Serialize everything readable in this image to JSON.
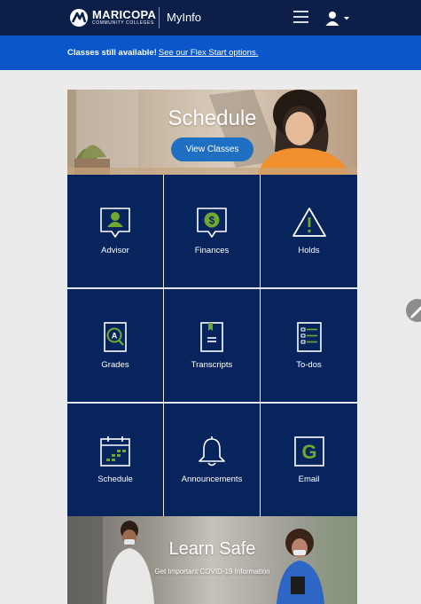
{
  "header": {
    "logo_name": "MARICOPA",
    "logo_sub": "COMMUNITY COLLEGES",
    "app_name": "MyInfo",
    "menu_icon": "hamburger-icon",
    "user_icon": "user-icon"
  },
  "notice": {
    "bold_text": "Classes still available!",
    "link_text": "See our Flex Start options."
  },
  "hero": {
    "title": "Schedule",
    "button_label": "View Classes"
  },
  "tiles": [
    {
      "label": "Advisor",
      "icon": "advisor-icon"
    },
    {
      "label": "Finances",
      "icon": "finances-icon"
    },
    {
      "label": "Holds",
      "icon": "holds-icon"
    },
    {
      "label": "Grades",
      "icon": "grades-icon"
    },
    {
      "label": "Transcripts",
      "icon": "transcripts-icon"
    },
    {
      "label": "To-dos",
      "icon": "todos-icon"
    },
    {
      "label": "Schedule",
      "icon": "schedule-icon"
    },
    {
      "label": "Announcements",
      "icon": "bell-icon"
    },
    {
      "label": "Email",
      "icon": "email-icon"
    }
  ],
  "learn_safe": {
    "title": "Learn Safe",
    "subtitle": "Get Important COVID-19 Information"
  },
  "colors": {
    "header_bg": "#0b1f49",
    "notice_bg": "#0b57c9",
    "tile_bg": "#07245c",
    "accent_green": "#6fa832",
    "button_blue": "#1f6fc2",
    "page_bg": "#ebebec"
  }
}
